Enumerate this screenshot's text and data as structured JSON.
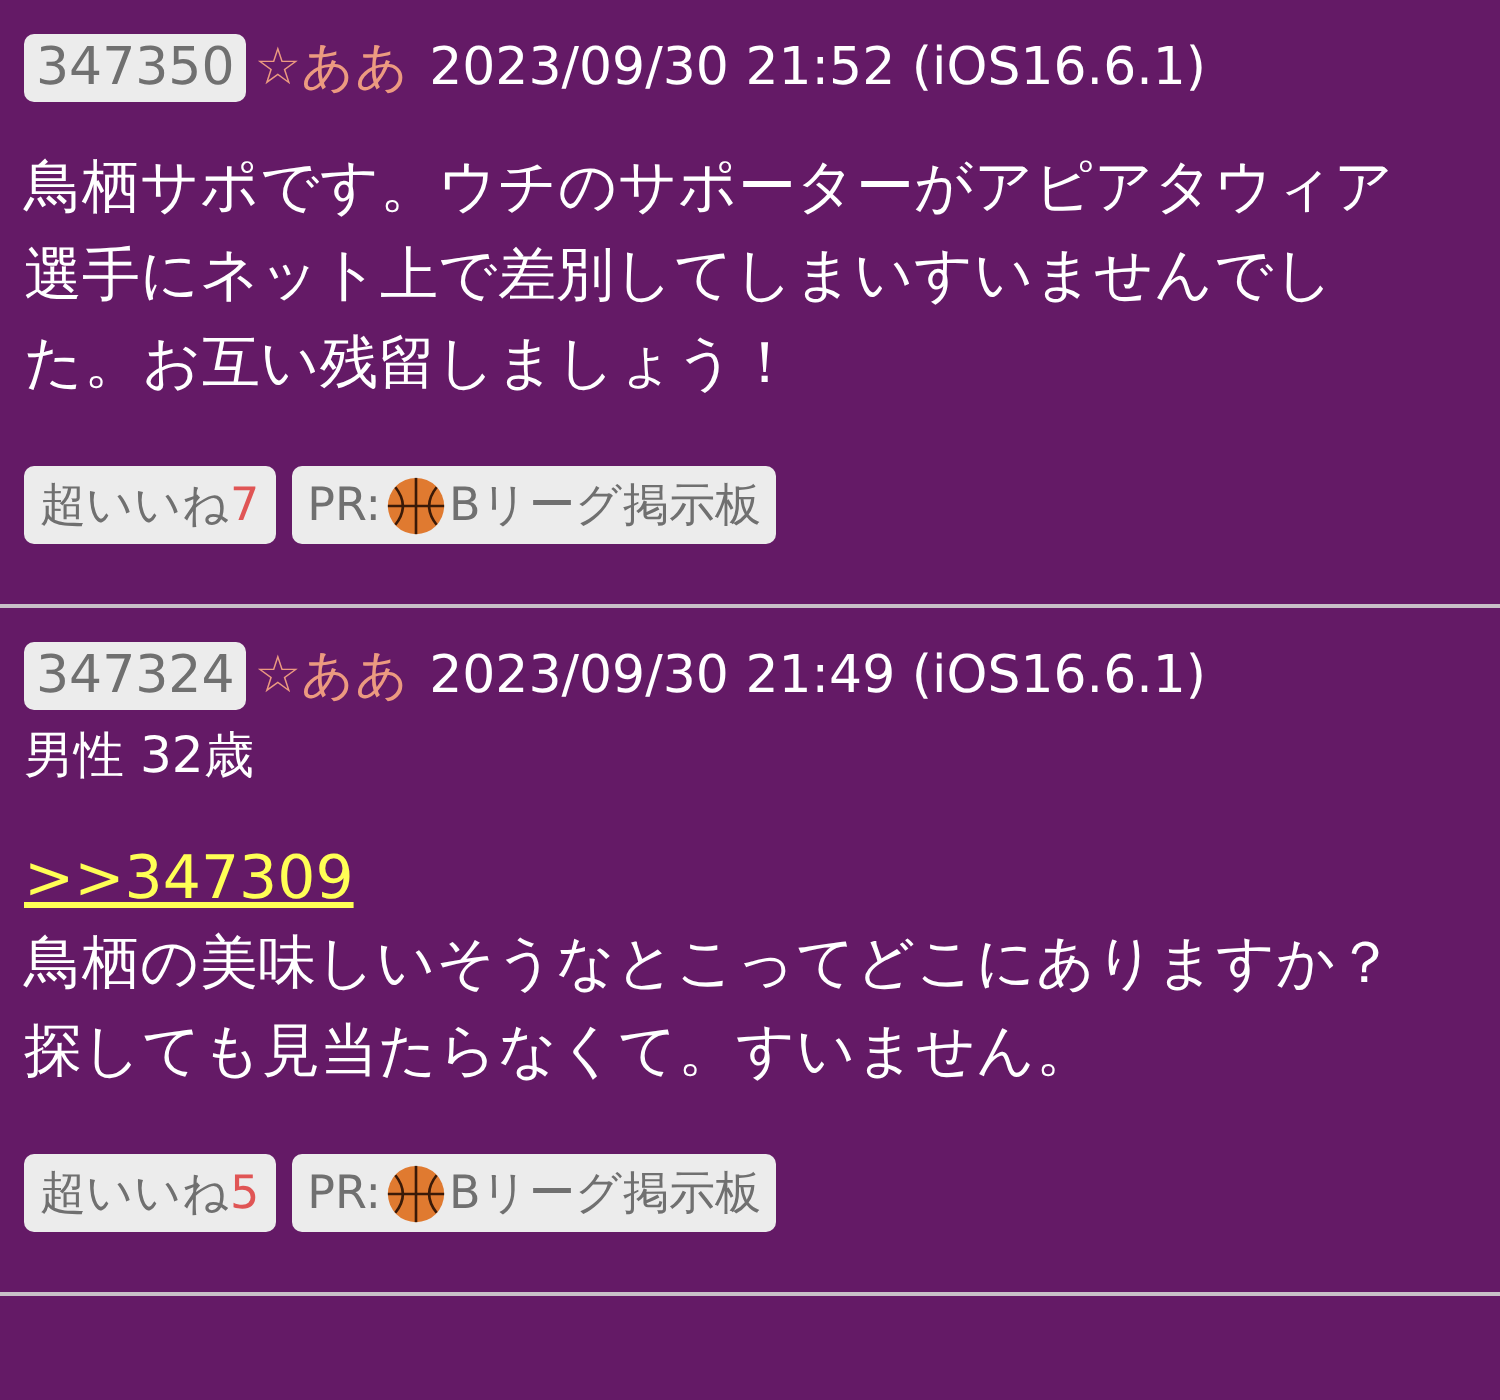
{
  "posts": [
    {
      "number": "347350",
      "name": "☆ああ",
      "date": "2023/09/30 21:52 (iOS16.6.1)",
      "body": "鳥栖サポです。ウチのサポーターがアピアタウィア選手にネット上で差別してしまいすいませんでした。お互い残留しましょう！",
      "like_label": "超いいね",
      "like_count": "7",
      "pr_label": "PR:",
      "pr_text": "Bリーグ掲示板"
    },
    {
      "number": "347324",
      "name": "☆ああ",
      "date": "2023/09/30 21:49 (iOS16.6.1)",
      "profile": "男性 32歳",
      "reply_to": ">>347309",
      "body": "鳥栖の美味しいそうなとこってどこにありますか？探しても見当たらなくて。すいません。",
      "like_label": "超いいね",
      "like_count": "5",
      "pr_label": "PR:",
      "pr_text": "Bリーグ掲示板"
    }
  ]
}
